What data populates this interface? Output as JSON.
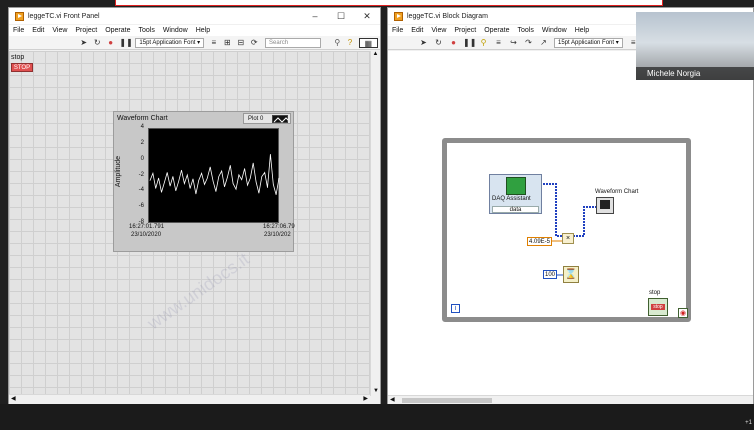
{
  "front_panel": {
    "title": "leggeTC.vi Front Panel",
    "menu": [
      "File",
      "Edit",
      "View",
      "Project",
      "Operate",
      "Tools",
      "Window",
      "Help"
    ],
    "font": "15pt Application Font",
    "search_placeholder": "Search",
    "stop_label": "stop",
    "stop_button": "STOP",
    "chart": {
      "label": "Waveform Chart",
      "legend": "Plot 0",
      "ylabel": "Amplitude",
      "yticks": [
        "4",
        "2",
        "0",
        "-2",
        "-4",
        "-6",
        "-8"
      ],
      "x_start_time": "16:27:01.791",
      "x_start_date": "23/10/2020",
      "x_end_time": "16:27:06.79",
      "x_end_date": "23/10/202"
    }
  },
  "chart_data": {
    "type": "line",
    "title": "Waveform Chart",
    "xlabel": "",
    "ylabel": "Amplitude",
    "ylim": [
      -8,
      4
    ],
    "grid": false,
    "legend": "top-right",
    "series": [
      {
        "name": "Plot 0",
        "values": [
          -2.5,
          -1.6,
          -3.5,
          -2.2,
          -4.0,
          -2.8,
          -1.5,
          -3.2,
          -2.0,
          -3.8,
          -2.6,
          -1.2,
          -2.9,
          -1.8,
          -3.5,
          -2.3,
          -4.2,
          -2.5,
          -1.6,
          -3.0,
          -2.2,
          -0.8,
          -2.6,
          -3.9,
          -2.0,
          -1.3,
          -3.3,
          -2.1,
          -0.6,
          -2.9,
          -3.6,
          -1.8,
          -2.4,
          -1.0,
          -3.1,
          -2.2,
          -0.3,
          -2.7,
          -4.1,
          -2.0,
          -1.5,
          -3.4,
          0.8,
          -3.0,
          -4.3,
          -2.2
        ]
      }
    ]
  },
  "block_diagram": {
    "title": "leggeTC.vi Block Diagram",
    "menu": [
      "File",
      "Edit",
      "View",
      "Project",
      "Operate",
      "Tools",
      "Window",
      "Help"
    ],
    "font": "15pt Application Font",
    "daq_label": "DAQ Assistant",
    "daq_terminal": "data",
    "chart_terminal": "Waveform Chart",
    "constant": "4.09E-5",
    "wait_constant": "100",
    "stop_label": "stop",
    "stop_terminal": "stop",
    "loop_iteration": "i"
  },
  "webcam": {
    "name": "Michele Norgia"
  },
  "watermark": "www.unidocs.it",
  "taskbar_badge": "+1"
}
